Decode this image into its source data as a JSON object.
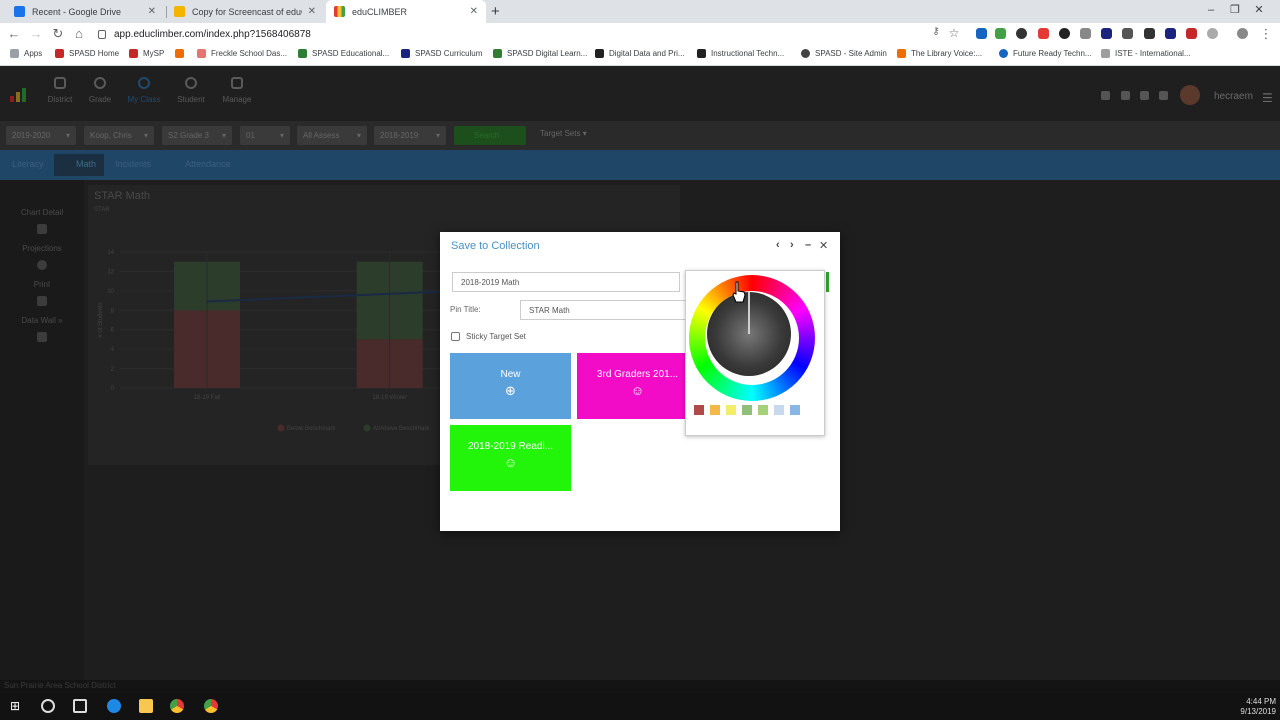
{
  "browser": {
    "tabs": [
      {
        "title": "Recent - Google Drive",
        "color": "#1a73e8"
      },
      {
        "title": "Copy for Screencast of eduCLIMB",
        "color": "#f4b400"
      },
      {
        "title": "eduCLIMBER",
        "color": "#34a853"
      }
    ],
    "url": "app.educlimber.com/index.php?1568406878",
    "bookmarks": [
      {
        "label": "Apps",
        "color": "#9aa0a6"
      },
      {
        "label": "SPASD Home",
        "color": "#c62828"
      },
      {
        "label": "MySP",
        "color": "#c62828"
      },
      {
        "label": "Freckle School Das...",
        "color": "#e57373"
      },
      {
        "label": "SPASD Educational...",
        "color": "#2e7d32"
      },
      {
        "label": "SPASD Curriculum",
        "color": "#1a237e"
      },
      {
        "label": "SPASD Digital Learn...",
        "color": "#2e7d32"
      },
      {
        "label": "Digital Data and Pri...",
        "color": "#212121"
      },
      {
        "label": "Instructional Techn...",
        "color": "#212121"
      },
      {
        "label": "SPASD - Site Admin",
        "color": "#424242"
      },
      {
        "label": "The Library Voice:...",
        "color": "#ef6c00"
      },
      {
        "label": "Future Ready Techn...",
        "color": "#1565c0"
      },
      {
        "label": "ISTE - International...",
        "color": "#9e9e9e"
      }
    ]
  },
  "app": {
    "nav": [
      "District",
      "Grade",
      "My Class",
      "Student",
      "Manage"
    ],
    "username": "hecraem",
    "filters": [
      "2019-2020",
      "Koop, Chris",
      "S2 Grade 3",
      "01",
      "All Assess",
      "2018-2019"
    ],
    "search_label": "Search",
    "target_sets_label": "Target Sets",
    "subject_tabs": [
      "Literacy",
      "Math",
      "Incidents",
      "Attendance"
    ],
    "left_panel": [
      "Chart Detail",
      "Projections",
      "Print",
      "Data Wall »"
    ],
    "chart_title": "STAR Math",
    "chart_subtitle": "STAR",
    "footer": "Sun Prairie Area School District"
  },
  "chart_data": {
    "type": "bar",
    "categories": [
      "18-19 Fall",
      "18-19 Winter"
    ],
    "series": [
      {
        "name": "Below Benchmark",
        "values": [
          8,
          5
        ],
        "color": "#4a2b2b"
      },
      {
        "name": "At/Above Benchmark",
        "values": [
          5,
          8
        ],
        "color": "#2c3d2c"
      }
    ],
    "line": {
      "values": [
        8.9,
        9.7
      ],
      "color": "#1a2a44"
    },
    "yticks": [
      0,
      2,
      4,
      6,
      8,
      10,
      12,
      14
    ],
    "ylim": [
      0,
      14
    ],
    "ylabel": "# of Students"
  },
  "modal": {
    "title": "Save to Collection",
    "collection_value": "2018-2019 Math",
    "pin_title_label": "Pin Title:",
    "pin_title_value": "STAR Math",
    "sticky_label": "Sticky Target Set",
    "tiles": [
      {
        "label": "New",
        "icon": "plus-circle-icon",
        "color": "#5ba2dd"
      },
      {
        "label": "3rd Graders 201...",
        "icon": "smiley-icon",
        "color": "#f20cc7"
      },
      {
        "label": "2018-2019 Readi...",
        "icon": "smiley-icon",
        "color": "#23f50a"
      }
    ]
  },
  "color_picker": {
    "swatches": [
      "#b04a4a",
      "#f2b84a",
      "#f2ee6a",
      "#8fbf7a",
      "#a4d07a",
      "#c6d8ec",
      "#8ab6e6"
    ]
  },
  "taskbar": {
    "time": "4:44 PM",
    "date": "9/13/2019"
  }
}
